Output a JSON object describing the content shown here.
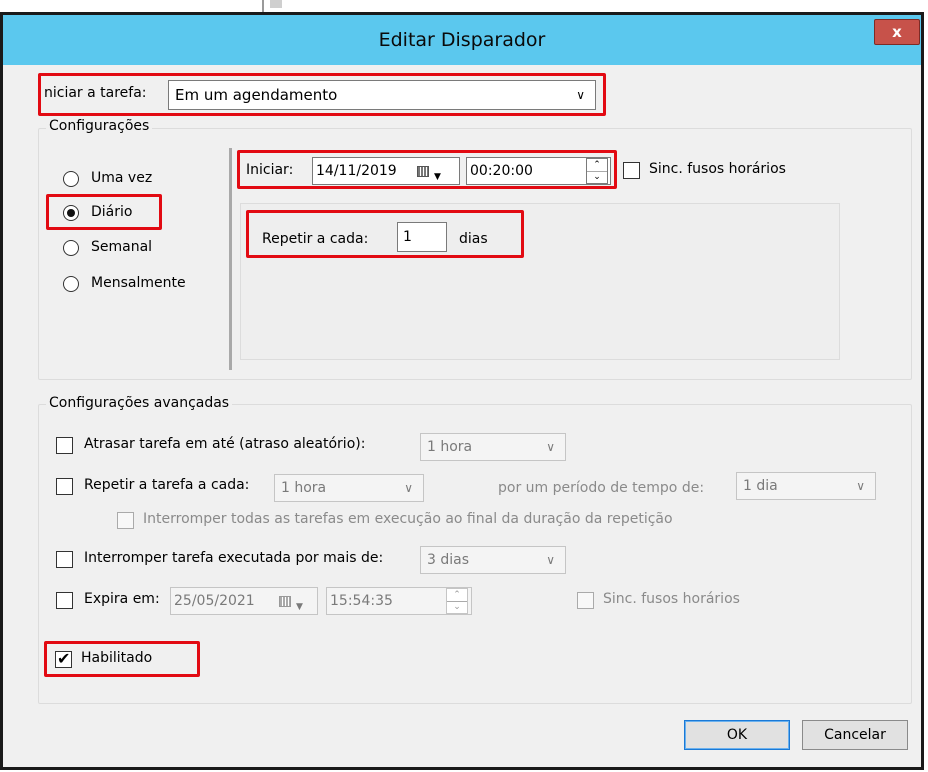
{
  "dialog": {
    "title": "Editar Disparador",
    "close_glyph": "x"
  },
  "start_task": {
    "label": "niciar a tarefa:",
    "value": "Em um agendamento"
  },
  "settings": {
    "legend": "Configurações",
    "radios": [
      {
        "label": "Uma vez",
        "selected": false
      },
      {
        "label": "Diário",
        "selected": true
      },
      {
        "label": "Semanal",
        "selected": false
      },
      {
        "label": "Mensalmente",
        "selected": false
      }
    ],
    "start_label": "Iniciar:",
    "start_date": "14/11/2019",
    "start_time": "00:20:00",
    "sync_label": "Sinc. fusos horários",
    "repeat_label": "Repetir a cada:",
    "repeat_value": "1",
    "repeat_unit": "dias"
  },
  "advanced": {
    "legend": "Configurações avançadas",
    "delay_label": "Atrasar tarefa em até (atraso aleatório):",
    "delay_value": "1 hora",
    "repeat_label": "Repetir a tarefa a cada:",
    "repeat_value": "1 hora",
    "duration_label": "por um período de tempo de:",
    "duration_value": "1 dia",
    "stop_all_label": "Interromper todas as tarefas em execução ao final da duração da repetição",
    "stop_longer_label": "Interromper tarefa executada por mais de:",
    "stop_longer_value": "3 dias",
    "expire_label": "Expira em:",
    "expire_date": "25/05/2021",
    "expire_time": "15:54:35",
    "expire_sync_label": "Sinc. fusos horários",
    "enabled_label": "Habilitado",
    "check_glyph": "✔"
  },
  "buttons": {
    "ok": "OK",
    "cancel": "Cancelar"
  },
  "colors": {
    "titlebar": "#5bc8ee",
    "highlight": "#e20a12",
    "close": "#c7524a"
  }
}
